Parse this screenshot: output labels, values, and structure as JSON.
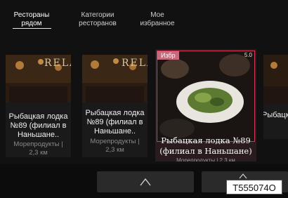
{
  "tabs": [
    {
      "label": "Рестораны рядом"
    },
    {
      "label": "Категории ресторанов"
    },
    {
      "label": "Мое избранное"
    }
  ],
  "cards": [
    {
      "name": "Рыбацкая лодка №89 (филиал в Наньшане..",
      "category": "Морепродукты |",
      "distance": "2,3 км"
    },
    {
      "name": "Рыбацкая лодка №89 (филиал в Наньшане..",
      "category": "Морепродукты |",
      "distance": "2,3 км"
    },
    {
      "name": "Рыбацкая лодка №89 (филиал в Наньшане)",
      "badge": "Избр",
      "rating": "5.0",
      "meta": "Морепродукты | 2,3 км"
    },
    {
      "name": "Рыбацк ая",
      "category": "",
      "distance": ""
    }
  ],
  "sign_text": "RELA",
  "watermark": "T555074O"
}
